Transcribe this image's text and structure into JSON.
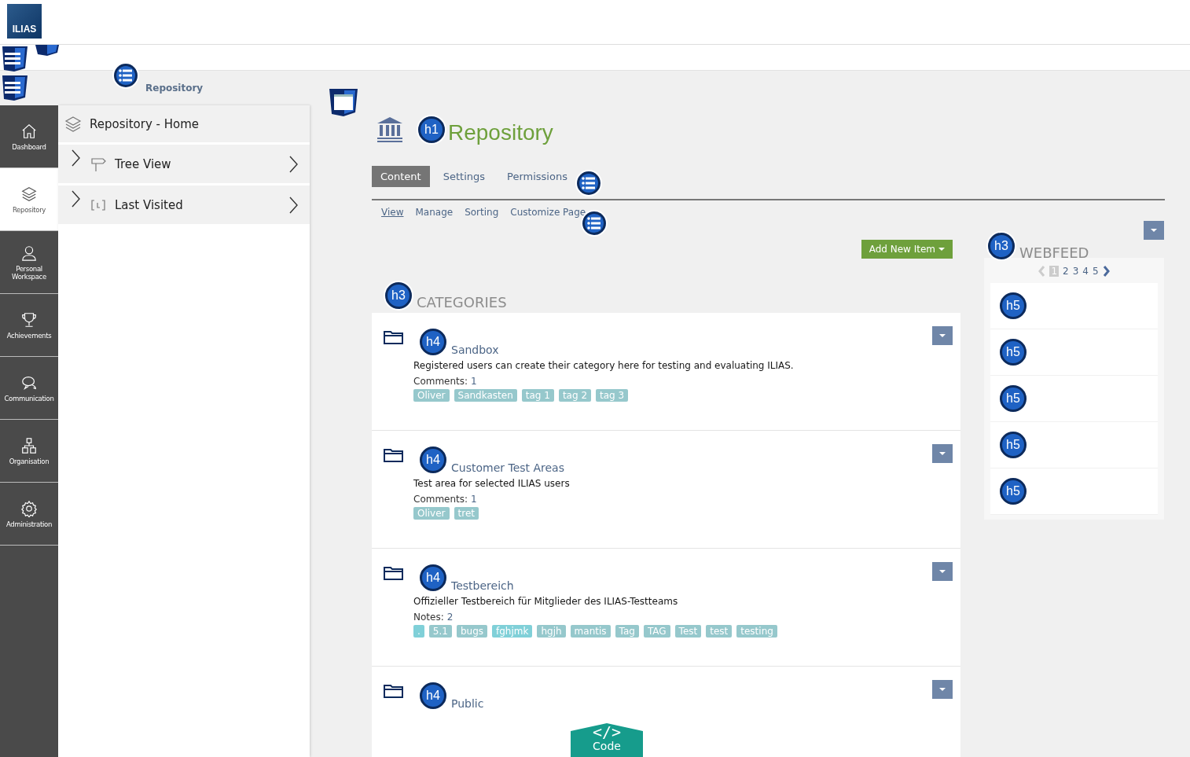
{
  "header": {
    "logo": "ILIAS"
  },
  "breadcrumb": {
    "label": "Repository"
  },
  "mainbar": [
    {
      "label": "Dashboard",
      "kind": "home",
      "selected": false
    },
    {
      "label": "Repository",
      "kind": "layers",
      "selected": true
    },
    {
      "label": "Personal Workspace",
      "kind": "person",
      "selected": false
    },
    {
      "label": "Achievements",
      "kind": "trophy",
      "selected": false
    },
    {
      "label": "Communication",
      "kind": "chat",
      "selected": false
    },
    {
      "label": "Organisation",
      "kind": "org",
      "selected": false
    },
    {
      "label": "Administration",
      "kind": "gear",
      "selected": false
    }
  ],
  "slate": [
    {
      "label": "Repository - Home",
      "kind": "layers",
      "expandable": false
    },
    {
      "label": "Tree View",
      "kind": "signpost",
      "expandable": true
    },
    {
      "label": "Last Visited",
      "kind": "bracket",
      "expandable": true
    }
  ],
  "page": {
    "badge": "h1",
    "title": "Repository",
    "tabs": [
      {
        "label": "Content",
        "selected": true
      },
      {
        "label": "Settings",
        "selected": false
      },
      {
        "label": "Permissions",
        "selected": false
      }
    ],
    "subtabs": [
      {
        "label": "View",
        "selected": true
      },
      {
        "label": "Manage",
        "selected": false
      },
      {
        "label": "Sorting",
        "selected": false
      },
      {
        "label": "Customize Page",
        "selected": false
      }
    ],
    "add_button": "Add New Item"
  },
  "categories": {
    "badge": "h3",
    "title": "CATEGORIES",
    "items": [
      {
        "badge": "h4",
        "title": "Sandbox",
        "description": "Registered users can create their category here for testing and evaluating ILIAS.",
        "meta_label": "Comments:",
        "meta_value": "1",
        "tags": [
          {
            "label": "Oliver",
            "color": "#96c8cc"
          },
          {
            "label": "Sandkasten",
            "color": "#96c8cc"
          },
          {
            "label": "tag 1",
            "color": "#96c8cc"
          },
          {
            "label": "tag 2",
            "color": "#96c8cc"
          },
          {
            "label": "tag 3",
            "color": "#96c8cc"
          }
        ]
      },
      {
        "badge": "h4",
        "title": "Customer Test Areas",
        "description": "Test area for selected ILIAS users",
        "meta_label": "Comments:",
        "meta_value": "1",
        "tags": [
          {
            "label": "Oliver",
            "color": "#96c8cc"
          },
          {
            "label": "tret",
            "color": "#96c8cc"
          }
        ]
      },
      {
        "badge": "h4",
        "title": "Testbereich",
        "description": "Offizieller Testbereich für Mitglieder des ILIAS-Testteams",
        "meta_label": "Notes:",
        "meta_value": "2",
        "tags": [
          {
            "label": ".",
            "color": "#80d0d8"
          },
          {
            "label": "5.1",
            "color": "#96c8cc"
          },
          {
            "label": "bugs",
            "color": "#96c8cc"
          },
          {
            "label": "fghjmk",
            "color": "#80d0d8"
          },
          {
            "label": "hgjh",
            "color": "#96c8cc"
          },
          {
            "label": "mantis",
            "color": "#96c8cc"
          },
          {
            "label": "Tag",
            "color": "#96c8cc"
          },
          {
            "label": "TAG",
            "color": "#96c8cc"
          },
          {
            "label": "Test",
            "color": "#96c8cc"
          },
          {
            "label": "test",
            "color": "#96c8cc"
          },
          {
            "label": "testing",
            "color": "#96c8cc"
          }
        ]
      },
      {
        "badge": "h4",
        "title": "Public"
      }
    ]
  },
  "webfeed": {
    "badge": "h3",
    "title": "WEBFEED",
    "pages": [
      {
        "label": "1",
        "selected": true
      },
      {
        "label": "2",
        "selected": false
      },
      {
        "label": "3",
        "selected": false
      },
      {
        "label": "4",
        "selected": false
      },
      {
        "label": "5",
        "selected": false
      }
    ],
    "entries": [
      {
        "badge": "h5"
      },
      {
        "badge": "h5"
      },
      {
        "badge": "h5"
      },
      {
        "badge": "h5"
      },
      {
        "badge": "h5"
      }
    ]
  },
  "code_tab": {
    "glyph": "</>",
    "label": "Code"
  }
}
